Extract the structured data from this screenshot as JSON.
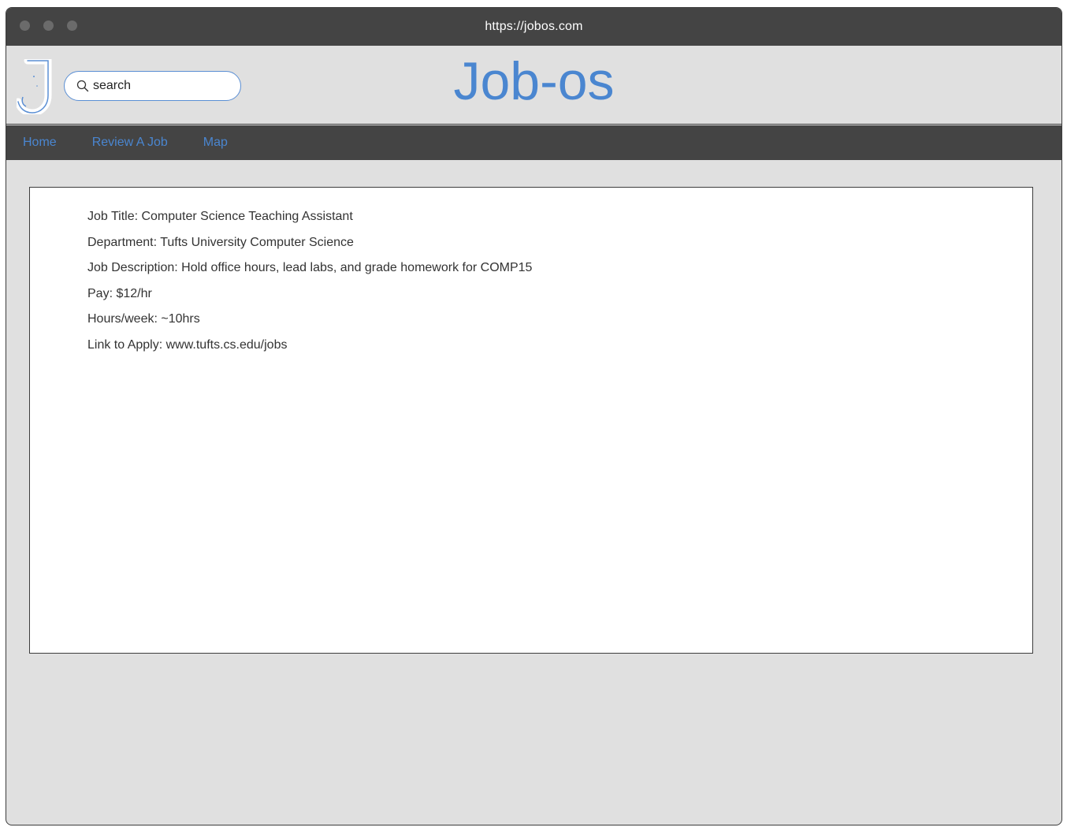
{
  "browser": {
    "url": "https://jobos.com"
  },
  "header": {
    "logo_letter": "J",
    "brand": "Job-os",
    "search": {
      "placeholder": "search",
      "icon": "search-icon"
    }
  },
  "nav": {
    "items": [
      {
        "label": "Home"
      },
      {
        "label": "Review A Job"
      },
      {
        "label": "Map"
      }
    ]
  },
  "job": {
    "title": "Job Title: Computer Science Teaching Assistant",
    "department": "Department: Tufts University Computer Science",
    "description": "Job Description: Hold office hours, lead labs, and grade homework for COMP15",
    "pay": "Pay:  $12/hr",
    "hours": "Hours/week: ~10hrs",
    "link": "Link to Apply: www.tufts.cs.edu/jobs"
  },
  "colors": {
    "accent": "#4a86d0",
    "chrome": "#444444",
    "background": "#e0e0e0"
  }
}
